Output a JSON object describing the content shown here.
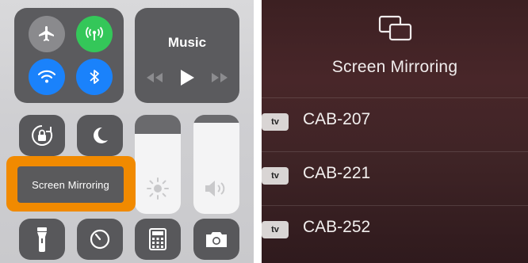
{
  "control_center": {
    "music": {
      "title": "Music"
    },
    "screen_mirroring_label": "Screen Mirroring",
    "highlight_color": "#f18a00",
    "icons": [
      "airplane-icon",
      "cellular-icon",
      "wifi-icon",
      "bluetooth-icon",
      "rotation-lock-icon",
      "do-not-disturb-icon",
      "brightness-icon",
      "volume-icon",
      "flashlight-icon",
      "timer-icon",
      "calculator-icon",
      "camera-icon"
    ]
  },
  "screen_mirroring": {
    "title": "Screen Mirroring",
    "badge": "tv",
    "devices": [
      "CAB-207",
      "CAB-221",
      "CAB-252"
    ]
  }
}
